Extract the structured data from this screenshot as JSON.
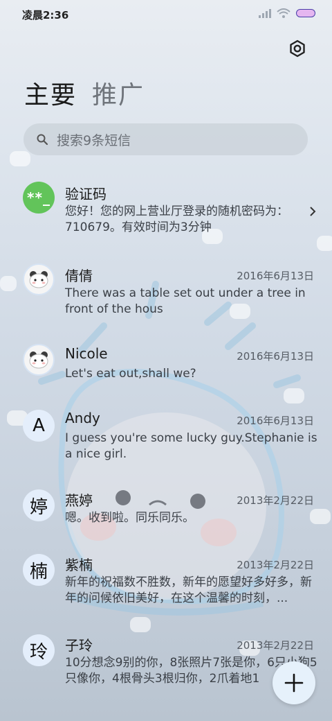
{
  "status": {
    "time": "凌晨2:36"
  },
  "tabs": [
    {
      "label": "主要"
    },
    {
      "label": "推广"
    }
  ],
  "search": {
    "placeholder": "搜索9条短信"
  },
  "threads": [
    {
      "name": "验证码",
      "date": "",
      "avatar": "**_",
      "preview": "您好！您的网上营业厅登录的随机密码为：710679。有效时间为3分钟"
    },
    {
      "name": "倩倩",
      "date": "2016年6月13日",
      "avatar": "bear",
      "preview": "There was a table set out under a tree in front of the hous"
    },
    {
      "name": "Nicole",
      "date": "2016年6月13日",
      "avatar": "bear",
      "preview": "Let's eat out,shall we?"
    },
    {
      "name": "Andy",
      "date": "2016年6月13日",
      "avatar": "A",
      "preview": "I guess you're some lucky guy.Stephanie is a nice girl."
    },
    {
      "name": "燕婷",
      "date": "2013年2月22日",
      "avatar": "婷",
      "preview": "嗯。收到啦。同乐同乐。"
    },
    {
      "name": "紫楠",
      "date": "2013年2月22日",
      "avatar": "楠",
      "preview": "新年的祝福数不胜数，新年的愿望好多好多，新年的问候依旧美好，在这个温馨的时刻，..."
    },
    {
      "name": "子玲",
      "date": "2013年2月22日",
      "avatar": "玲",
      "preview": "10分想念9别的你，8张照片7张是你，6只小狗5只像你，4根骨头3根归你，2爪着地1"
    }
  ],
  "icons": {
    "settings": "gear-icon",
    "search": "search-icon",
    "compose": "plus-icon",
    "more": "chevron-right-icon"
  },
  "colors": {
    "green_avatar": "#62c45a",
    "letter_avatar": "#e4eefb"
  }
}
